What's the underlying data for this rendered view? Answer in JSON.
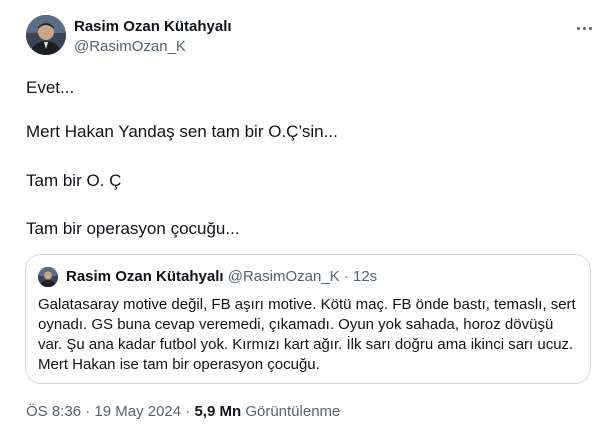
{
  "author": {
    "name": "Rasim Ozan Kütahyalı",
    "handle": "@RasimOzan_K"
  },
  "tweet": {
    "lines": [
      "Evet...",
      "Mert Hakan Yandaş sen tam bir O.Ç’sin...",
      "Tam bir O. Ç",
      "Tam bir operasyon çocuğu..."
    ]
  },
  "quote": {
    "name": "Rasim Ozan Kütahyalı",
    "handle": "@RasimOzan_K",
    "dot": "·",
    "time": "12s",
    "text": "Galatasaray motive değil, FB aşırı motive. Kötü maç. FB önde bastı, temaslı, sert oynadı. GS buna cevap veremedi, çıkamadı. Oyun yok sahada, horoz dövüşü var. Şu ana kadar futbol yok. Kırmızı kart ağır. İlk sarı doğru ama ikinci sarı ucuz. Mert Hakan ise tam bir operasyon çocuğu."
  },
  "meta": {
    "time": "ÖS 8:36",
    "sep1": "·",
    "date": "19 May 2024",
    "sep2": "·",
    "views_count": "5,9 Mn",
    "views_label": "Görüntülenme"
  },
  "icons": {
    "more": "more-dots-icon"
  }
}
